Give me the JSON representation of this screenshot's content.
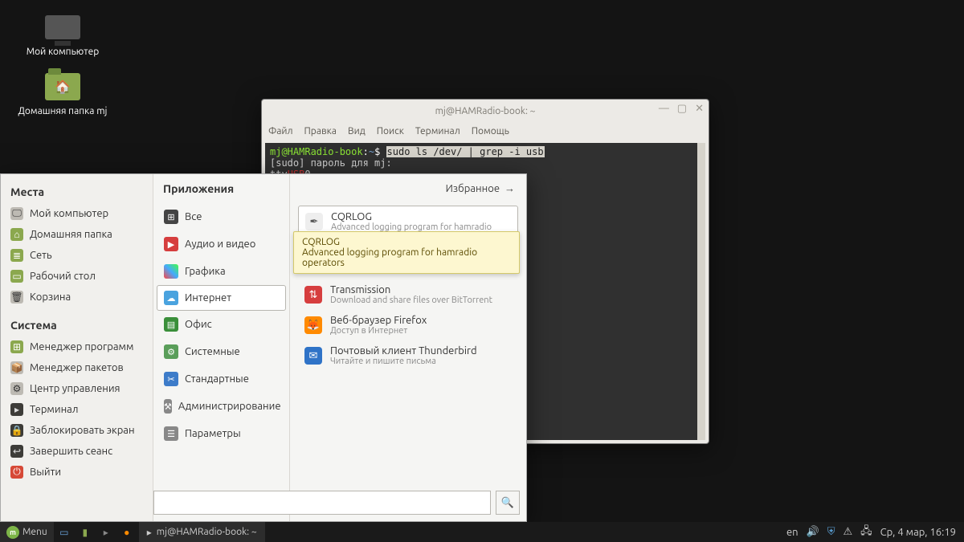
{
  "desktop": {
    "computer_label": "Мой компьютер",
    "home_label": "Домашняя папка mj"
  },
  "terminal": {
    "title": "mj@HAMRadio-book: ~",
    "menu": {
      "file": "Файл",
      "edit": "Правка",
      "view": "Вид",
      "search": "Поиск",
      "terminal": "Терминал",
      "help": "Помощь"
    },
    "prompt_user": "mj@HAMRadio-book",
    "prompt_path": "~",
    "prompt_sym": "$",
    "command": "sudo ls /dev/ | grep -i usb",
    "line2_pre": "[sudo] пароль для mj:",
    "line3_pre": "tty",
    "line3_usb": "USB",
    "line3_post": "0"
  },
  "startmenu": {
    "places_title": "Места",
    "places": {
      "computer": "Мой компьютер",
      "home": "Домашняя папка",
      "network": "Сеть",
      "desktop": "Рабочий стол",
      "trash": "Корзина"
    },
    "system_title": "Система",
    "system": {
      "software": "Менеджер программ",
      "packages": "Менеджер пакетов",
      "control": "Центр управления",
      "terminal": "Терминал",
      "lock": "Заблокировать экран",
      "logout": "Завершить сеанс",
      "quit": "Выйти"
    },
    "apps_title": "Приложения",
    "favorites": "Избранное",
    "categories": {
      "all": "Все",
      "av": "Аудио и видео",
      "graphics": "Графика",
      "internet": "Интернет",
      "office": "Офис",
      "system": "Системные",
      "standard": "Стандартные",
      "admin": "Администрирование",
      "prefs": "Параметры"
    },
    "apps": {
      "cqrlog": {
        "name": "CQRLOG",
        "desc": "Advanced logging program for hamradio operators"
      },
      "transmission": {
        "name": "Transmission",
        "desc": "Download and share files over BitTorrent"
      },
      "firefox": {
        "name": "Веб-браузер Firefox",
        "desc": "Доступ в Интернет"
      },
      "thunderbird": {
        "name": "Почтовый клиент Thunderbird",
        "desc": "Читайте и пишите письма"
      }
    },
    "tooltip": {
      "title": "CQRLOG",
      "desc": "Advanced logging program for hamradio operators"
    },
    "search_placeholder": ""
  },
  "taskbar": {
    "menu": "Menu",
    "task_title": "mj@HAMRadio-book: ~",
    "lang": "en",
    "clock": "Ср,  4 мар, 16:19"
  }
}
